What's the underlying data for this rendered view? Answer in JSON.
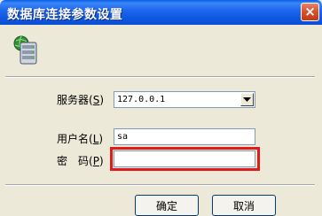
{
  "window": {
    "title": "数据库连接参数设置",
    "close_glyph": "×"
  },
  "form": {
    "server": {
      "label": "服务器",
      "accel_key": "S",
      "value": "127.0.0.1"
    },
    "username": {
      "label": "用户名",
      "accel_key": "L",
      "value": "sa"
    },
    "password": {
      "label": "密　码",
      "accel_key": "P",
      "value": ""
    }
  },
  "buttons": {
    "ok": "确定",
    "cancel": "取消"
  },
  "icons": {
    "header": "database-icon",
    "combo": "chevron-down-icon"
  },
  "colors": {
    "titlebar": "#0b5ce6",
    "close": "#d3502d",
    "highlight": "#e01b1b",
    "dialog_bg": "#ece9d8"
  }
}
